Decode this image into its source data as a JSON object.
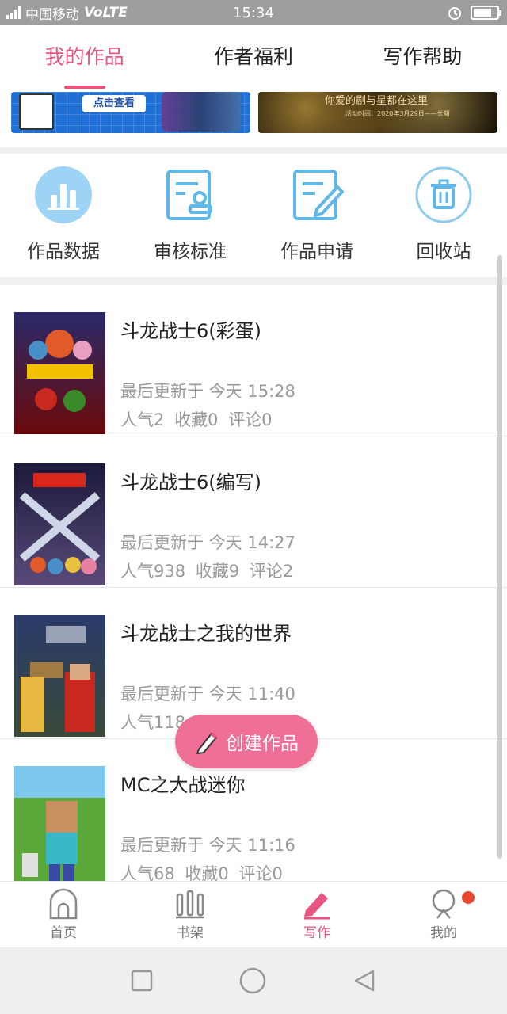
{
  "status_bar": {
    "signal_label": "4G",
    "carrier": "中国移动",
    "volte": "VoLTE",
    "time": "15:34",
    "battery_level": 0.8
  },
  "top_tabs": [
    {
      "label": "我的作品",
      "active": true
    },
    {
      "label": "作者福利",
      "active": false
    },
    {
      "label": "写作帮助",
      "active": false
    }
  ],
  "banners": {
    "left_button": "点击查看",
    "right_text": "你爱的剧与星都在这里",
    "right_subtext": "活动时间：2020年3月29日——长期"
  },
  "actions": [
    {
      "label": "作品数据",
      "icon": "bar-chart-icon"
    },
    {
      "label": "审核标准",
      "icon": "review-doc-icon"
    },
    {
      "label": "作品申请",
      "icon": "edit-doc-icon"
    },
    {
      "label": "回收站",
      "icon": "trash-icon"
    }
  ],
  "works": [
    {
      "title": "斗龙战士6(彩蛋)",
      "updated": "最后更新于 今天 15:28",
      "popularity": "人气2",
      "favorites": "收藏0",
      "comments": "评论0"
    },
    {
      "title": "斗龙战士6(编写)",
      "updated": "最后更新于 今天 14:27",
      "popularity": "人气938",
      "favorites": "收藏9",
      "comments": "评论2"
    },
    {
      "title": "斗龙战士之我的世界",
      "updated": "最后更新于 今天 11:40",
      "popularity": "人气118",
      "favorites": "",
      "comments": ""
    },
    {
      "title": "MC之大战迷你",
      "updated": "最后更新于 今天 11:16",
      "popularity": "人气68",
      "favorites": "收藏0",
      "comments": "评论0"
    }
  ],
  "fab": {
    "label": "创建作品"
  },
  "bottom_nav": [
    {
      "label": "首页",
      "icon": "home-icon",
      "active": false
    },
    {
      "label": "书架",
      "icon": "bookshelf-icon",
      "active": false
    },
    {
      "label": "写作",
      "icon": "pen-icon",
      "active": true
    },
    {
      "label": "我的",
      "icon": "profile-icon",
      "active": false
    }
  ],
  "colors": {
    "accent": "#e8537f",
    "icon_blue": "#5fb8e8",
    "fab": "#f06f96"
  }
}
